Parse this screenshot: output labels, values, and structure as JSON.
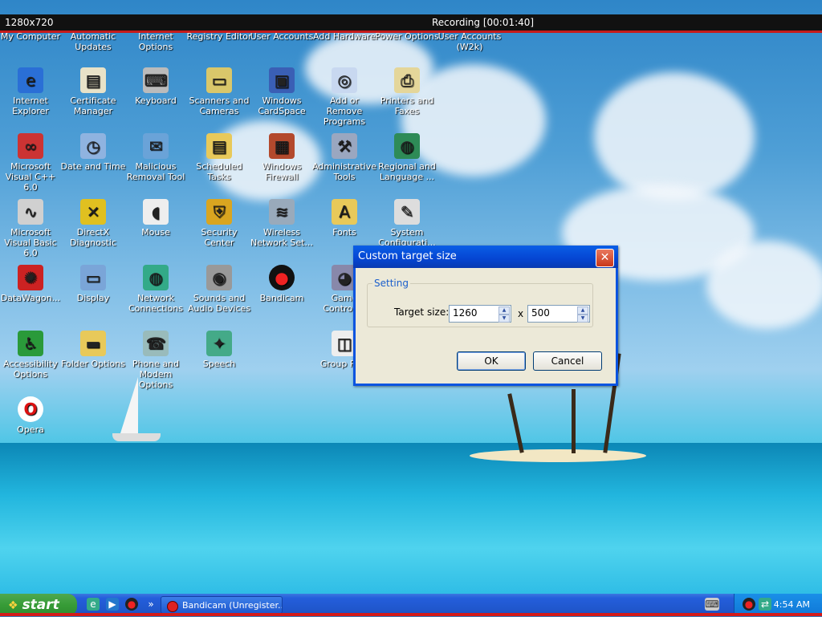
{
  "recording_bar": {
    "resolution": "1280x720",
    "status": "Recording [00:01:40]"
  },
  "desktop": {
    "top_row": [
      "My Computer",
      "Automatic Updates",
      "Internet Options",
      "Registry Editor",
      "User Accounts",
      "Add Hardware",
      "Power Options",
      "User Accounts (W2k)"
    ],
    "icons": [
      {
        "label": "Internet Explorer",
        "icon": "internet-explorer-icon"
      },
      {
        "label": "Certificate Manager",
        "icon": "certificate-icon"
      },
      {
        "label": "Keyboard",
        "icon": "keyboard-icon"
      },
      {
        "label": "Scanners and Cameras",
        "icon": "scanner-icon"
      },
      {
        "label": "Windows CardSpace",
        "icon": "cardspace-icon"
      },
      {
        "label": "Add or Remove Programs",
        "icon": "add-remove-icon"
      },
      {
        "label": "Printers and Faxes",
        "icon": "printer-icon"
      },
      {
        "label": "Microsoft Visual C++ 6.0",
        "icon": "visual-cpp-icon"
      },
      {
        "label": "Date and Time",
        "icon": "clock-icon"
      },
      {
        "label": "Malicious Removal Tool",
        "icon": "removal-tool-icon"
      },
      {
        "label": "Scheduled Tasks",
        "icon": "scheduled-tasks-icon"
      },
      {
        "label": "Windows Firewall",
        "icon": "firewall-icon"
      },
      {
        "label": "Administrative Tools",
        "icon": "admin-tools-icon"
      },
      {
        "label": "Regional and Language ...",
        "icon": "globe-icon"
      },
      {
        "label": "Microsoft Visual Basic 6.0",
        "icon": "visual-basic-icon"
      },
      {
        "label": "DirectX Diagnostic",
        "icon": "directx-icon"
      },
      {
        "label": "Mouse",
        "icon": "mouse-icon"
      },
      {
        "label": "Security Center",
        "icon": "shield-icon"
      },
      {
        "label": "Wireless Network Set...",
        "icon": "wireless-icon"
      },
      {
        "label": "Fonts",
        "icon": "fonts-folder-icon"
      },
      {
        "label": "System Configurati...",
        "icon": "system-config-icon"
      },
      {
        "label": "DataWagon...",
        "icon": "datawagon-icon"
      },
      {
        "label": "Display",
        "icon": "display-icon"
      },
      {
        "label": "Network Connections",
        "icon": "network-icon"
      },
      {
        "label": "Sounds and Audio Devices",
        "icon": "speaker-icon"
      },
      {
        "label": "Bandicam",
        "icon": "record-icon"
      },
      {
        "label": "Game Controll...",
        "icon": "gamepad-icon"
      },
      {
        "label": "Accessibility Options",
        "icon": "accessibility-icon"
      },
      {
        "label": "Folder Options",
        "icon": "folder-icon"
      },
      {
        "label": "Phone and Modem Options",
        "icon": "phone-icon"
      },
      {
        "label": "Speech",
        "icon": "speech-icon"
      },
      {
        "label": "Group Po...",
        "icon": "group-policy-icon"
      },
      {
        "label": "Opera",
        "icon": "opera-icon"
      }
    ]
  },
  "dialog": {
    "title": "Custom target size",
    "close_glyph": "✕",
    "group_label": "Setting",
    "target_label": "Target size:",
    "width_value": "1260",
    "separator": "x",
    "height_value": "500",
    "ok_label": "OK",
    "cancel_label": "Cancel"
  },
  "taskbar": {
    "start_label": "start",
    "task_button": "Bandicam (Unregister...",
    "chevron": "»",
    "clock": "4:54 AM"
  },
  "colors": {
    "title_bar": "#0a54e0",
    "recording_line": "#d31a1a",
    "start_green": "#379c37"
  }
}
